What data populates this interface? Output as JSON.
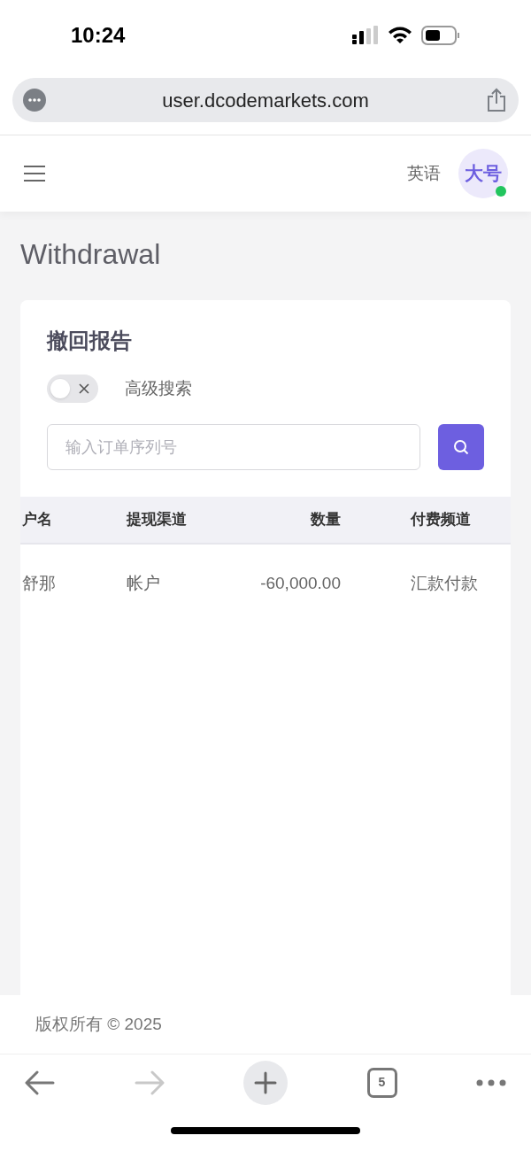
{
  "status_bar": {
    "time": "10:24"
  },
  "browser": {
    "url": "user.dcodemarkets.com"
  },
  "header": {
    "language": "英语",
    "avatar": "大号",
    "online": true
  },
  "page_title": "Withdrawal",
  "card": {
    "title": "撤回报告",
    "advanced_search": {
      "label": "高级搜索",
      "on": false
    },
    "search": {
      "placeholder": "输入订单序列号"
    }
  },
  "table": {
    "columns": [
      "户名",
      "提现渠道",
      "数量",
      "付费频道"
    ],
    "rows": [
      [
        "舒那",
        "帐户",
        "-60,000.00",
        "汇款付款"
      ]
    ]
  },
  "footer": "版权所有 © 2025",
  "toolbar": {
    "forward_disabled": true,
    "tabs_count": "5"
  }
}
